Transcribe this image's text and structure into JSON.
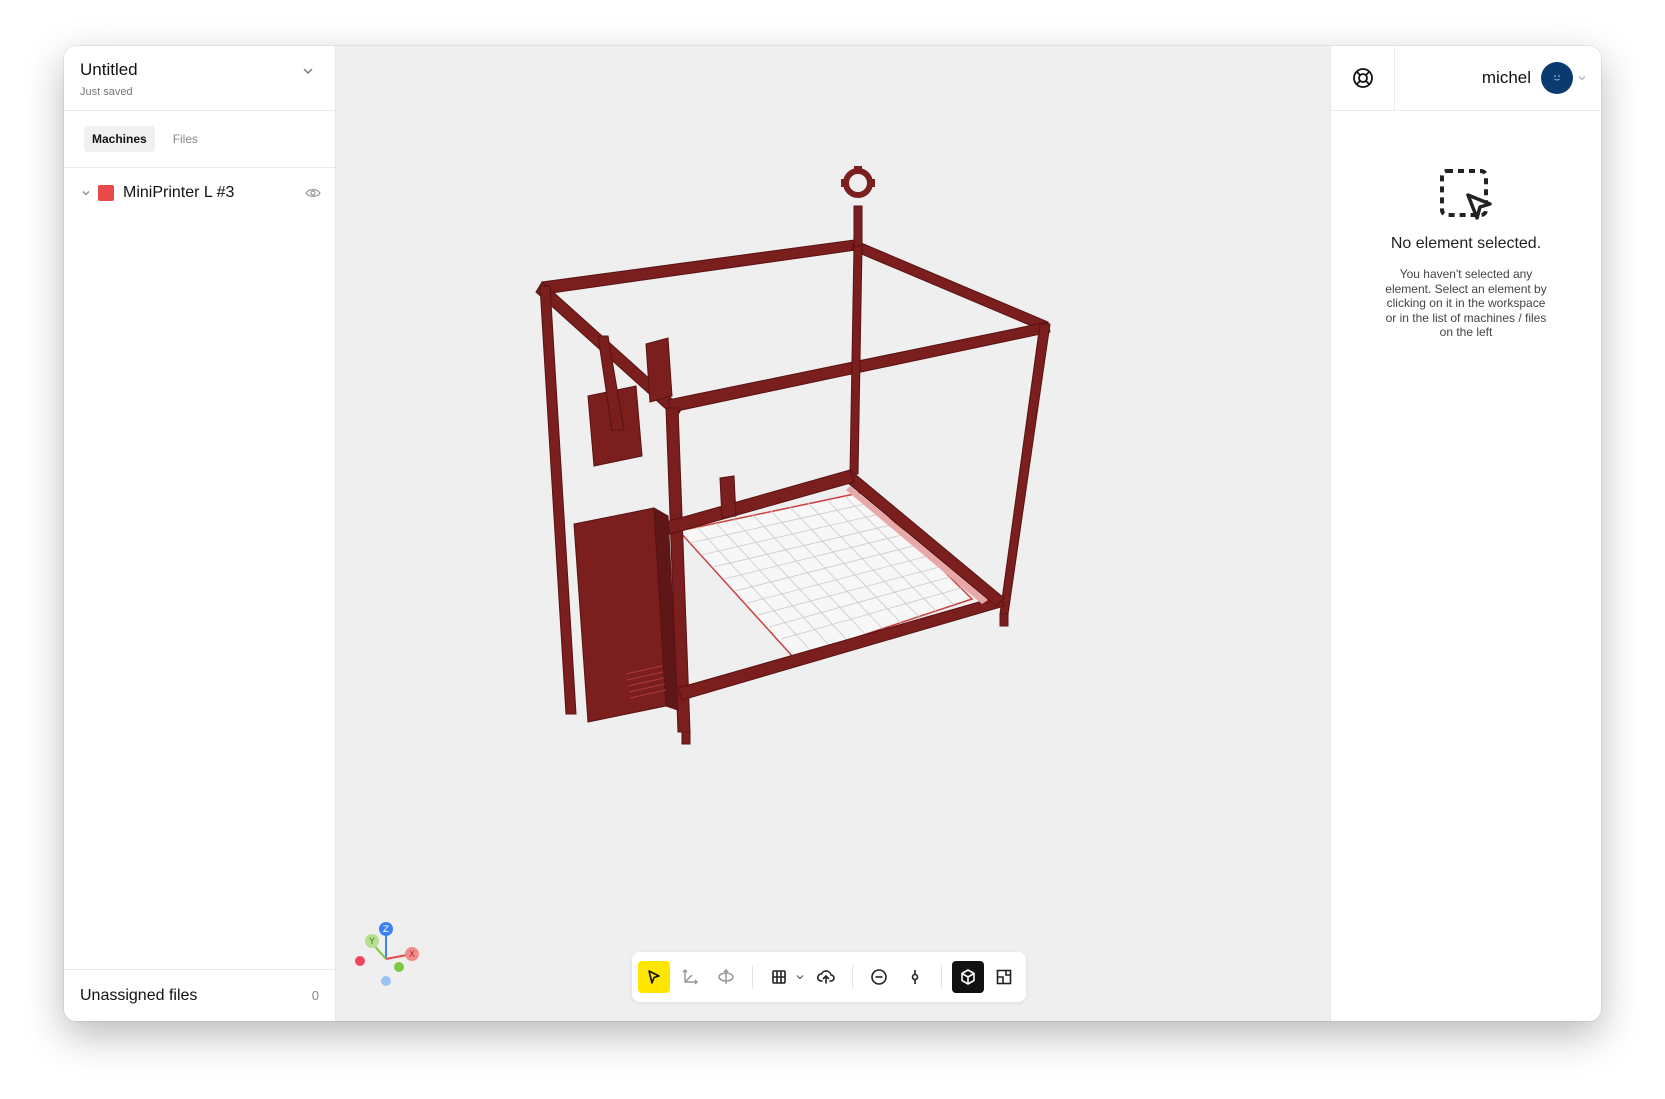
{
  "project": {
    "title": "Untitled",
    "status": "Just saved"
  },
  "sidebar": {
    "tabs": [
      {
        "label": "Machines"
      },
      {
        "label": "Files"
      }
    ],
    "machines": [
      {
        "name": "MiniPrinter L #3",
        "color": "#e84a4a"
      }
    ],
    "unassigned": {
      "label": "Unassigned files",
      "count": "0"
    }
  },
  "gizmo": {
    "z": "Z",
    "y": "Y",
    "x": "X"
  },
  "toolbar": {
    "tools": [
      "select-tool",
      "move-tool",
      "rotate-tool",
      "arrange-tool",
      "upload-tool",
      "remove-tool",
      "split-tool",
      "view-3d",
      "view-2d"
    ]
  },
  "user": {
    "name": "michel"
  },
  "inspector": {
    "empty_title": "No element selected.",
    "empty_desc": "You haven't selected any element. Select an element by clicking on it in the workspace or in the list of machines / files on the left"
  },
  "colors": {
    "frame": "#7a1e1e",
    "frame_light": "#e8a8a8",
    "accent": "#ffe600",
    "swatch": "#e84a4a"
  }
}
